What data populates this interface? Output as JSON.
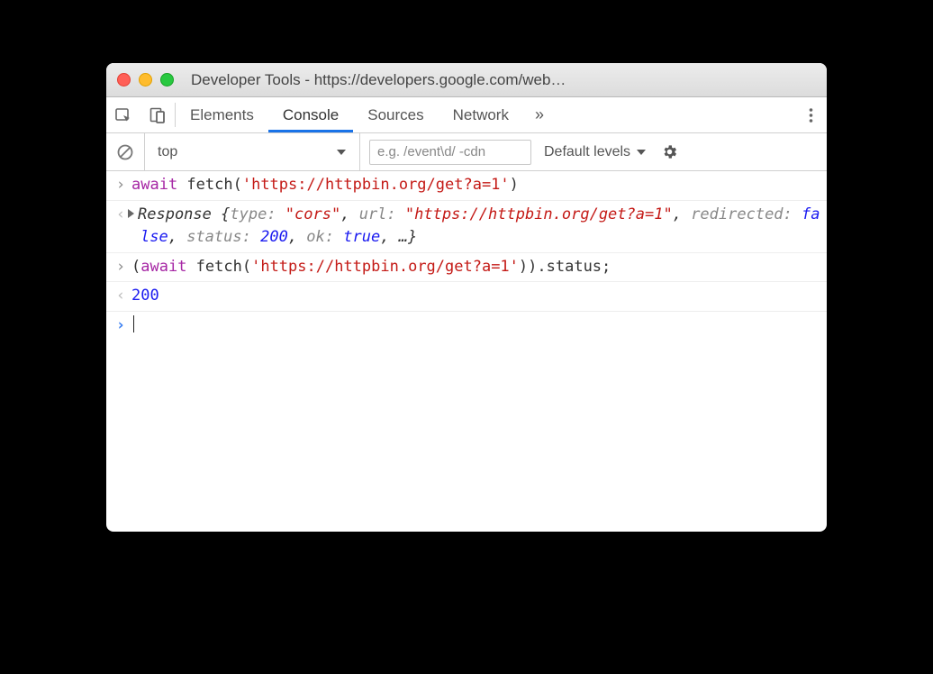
{
  "window": {
    "title": "Developer Tools - https://developers.google.com/web…"
  },
  "tabs": {
    "elements": "Elements",
    "console": "Console",
    "sources": "Sources",
    "network": "Network",
    "overflow": "»"
  },
  "toolbar": {
    "context": "top",
    "filter_placeholder": "e.g. /event\\d/ -cdn",
    "levels": "Default levels"
  },
  "console": {
    "line1": {
      "await": "await",
      "fetch": " fetch(",
      "url": "'https://httpbin.org/get?a=1'",
      "close": ")"
    },
    "line2": {
      "name": "Response",
      "open": " {",
      "k_type": "type: ",
      "v_type": "\"cors\"",
      "k_url": "url: ",
      "v_url": "\"https://httpbin.org/get?a=1\"",
      "k_redir": "redirected: ",
      "v_redir": "false",
      "k_status": "status: ",
      "v_status": "200",
      "k_ok": "ok: ",
      "v_ok": "true",
      "ellipsis": "…",
      "close": "}",
      "comma": ", "
    },
    "line3": {
      "open": "(",
      "await": "await",
      "fetch": " fetch(",
      "url": "'https://httpbin.org/get?a=1'",
      "closefn": ")",
      "prop": ").status;"
    },
    "line4": {
      "value": "200"
    }
  }
}
